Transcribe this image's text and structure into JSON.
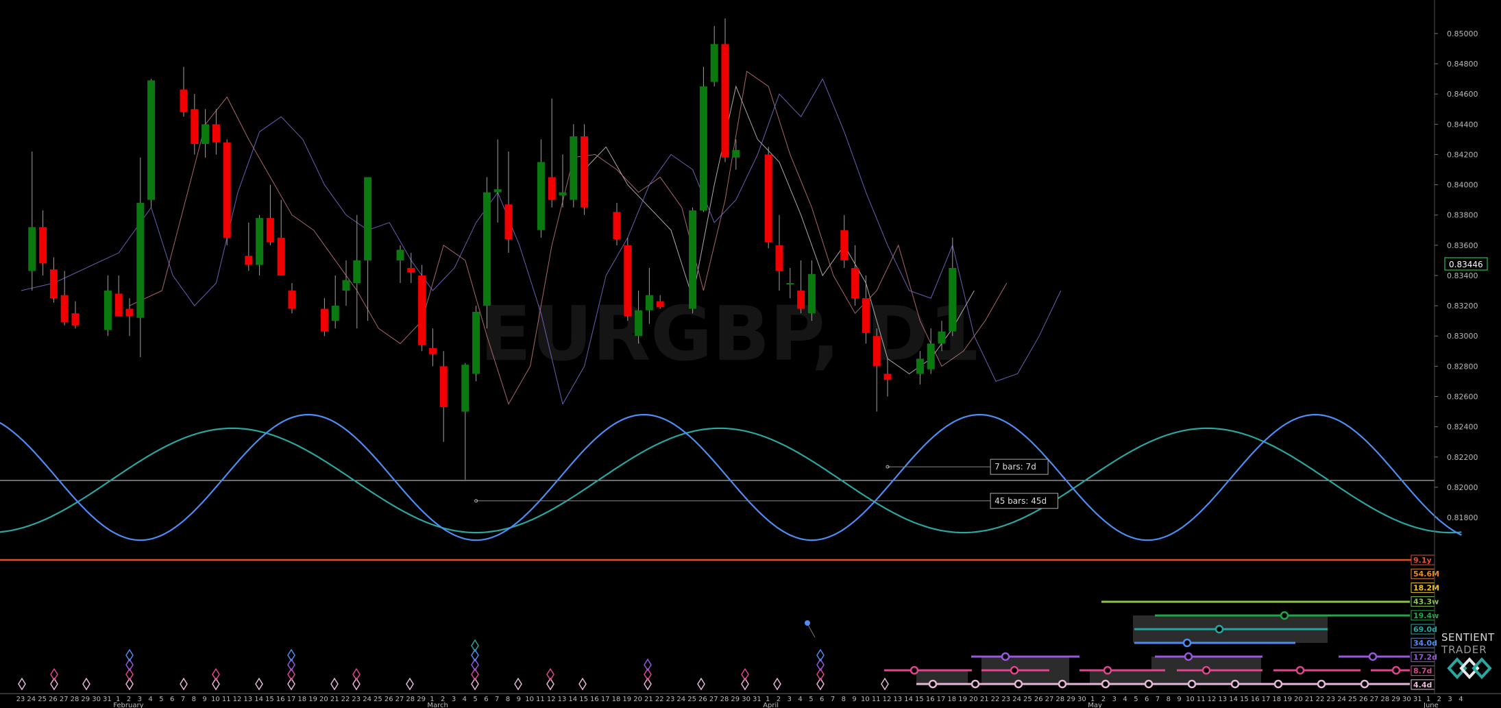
{
  "chart_data": {
    "type": "candlestick",
    "watermark": "EURGBP, D1",
    "last_price": "0.83446",
    "price_axis": [
      "0.85000",
      "0.84800",
      "0.84600",
      "0.84400",
      "0.84200",
      "0.84000",
      "0.83800",
      "0.83600",
      "0.83400",
      "0.83200",
      "0.83000",
      "0.82800",
      "0.82600",
      "0.82400",
      "0.82200",
      "0.82000",
      "0.81800"
    ],
    "ylim": [
      0.8156,
      0.8514
    ],
    "date_labels": [
      "23",
      "24",
      "25",
      "26",
      "27",
      "28",
      "29",
      "30",
      "31",
      "1",
      "2",
      "3",
      "4",
      "5",
      "6",
      "7",
      "8",
      "9",
      "10",
      "11",
      "12",
      "13",
      "14",
      "15",
      "16",
      "17",
      "18",
      "19",
      "20",
      "21",
      "22",
      "23",
      "24",
      "25",
      "26",
      "27",
      "28",
      "29",
      "1",
      "2",
      "3",
      "4",
      "5",
      "6",
      "7",
      "8",
      "9",
      "10",
      "11",
      "12",
      "13",
      "14",
      "15",
      "16",
      "17",
      "18",
      "19",
      "20",
      "21",
      "22",
      "23",
      "24",
      "25",
      "26",
      "27",
      "28",
      "29",
      "30",
      "31",
      "1",
      "2",
      "3",
      "4",
      "5",
      "6",
      "7",
      "8",
      "9",
      "10",
      "11",
      "12",
      "13",
      "14",
      "15",
      "16",
      "17",
      "18",
      "19",
      "20",
      "21",
      "22",
      "23",
      "24",
      "25",
      "26",
      "27",
      "28",
      "29",
      "30",
      "1",
      "2",
      "3",
      "4",
      "5",
      "6",
      "7",
      "8",
      "9",
      "10",
      "11",
      "12",
      "13",
      "14",
      "15",
      "16",
      "17",
      "18",
      "19",
      "20",
      "21",
      "22",
      "23",
      "24",
      "25",
      "26",
      "27",
      "28",
      "29",
      "30",
      "31",
      "1",
      "2",
      "3",
      "4"
    ],
    "month_labels": [
      {
        "index": 9,
        "text": "February"
      },
      {
        "index": 38,
        "text": "March"
      },
      {
        "index": 69,
        "text": "April"
      },
      {
        "index": 99,
        "text": "May"
      },
      {
        "index": 130,
        "text": "June"
      }
    ],
    "candles": [
      {
        "i": 1,
        "o": 0.8343,
        "h": 0.8422,
        "l": 0.833,
        "c": 0.8372
      },
      {
        "i": 2,
        "o": 0.8372,
        "h": 0.8383,
        "l": 0.834,
        "c": 0.8348
      },
      {
        "i": 3,
        "o": 0.8344,
        "h": 0.8352,
        "l": 0.8322,
        "c": 0.8325
      },
      {
        "i": 4,
        "o": 0.8327,
        "h": 0.8343,
        "l": 0.8307,
        "c": 0.8309
      },
      {
        "i": 5,
        "o": 0.8315,
        "h": 0.8323,
        "l": 0.8305,
        "c": 0.8307
      },
      {
        "i": 8,
        "o": 0.8304,
        "h": 0.834,
        "l": 0.83,
        "c": 0.833
      },
      {
        "i": 9,
        "o": 0.8328,
        "h": 0.834,
        "l": 0.8315,
        "c": 0.8313
      },
      {
        "i": 10,
        "o": 0.8318,
        "h": 0.8325,
        "l": 0.83,
        "c": 0.8313
      },
      {
        "i": 11,
        "o": 0.8312,
        "h": 0.8418,
        "l": 0.8286,
        "c": 0.8388
      },
      {
        "i": 12,
        "o": 0.839,
        "h": 0.847,
        "l": 0.8385,
        "c": 0.8469
      },
      {
        "i": 15,
        "o": 0.8463,
        "h": 0.8478,
        "l": 0.8445,
        "c": 0.8448
      },
      {
        "i": 16,
        "o": 0.845,
        "h": 0.846,
        "l": 0.842,
        "c": 0.8427
      },
      {
        "i": 17,
        "o": 0.8427,
        "h": 0.845,
        "l": 0.8418,
        "c": 0.844
      },
      {
        "i": 18,
        "o": 0.844,
        "h": 0.845,
        "l": 0.842,
        "c": 0.8428
      },
      {
        "i": 19,
        "o": 0.8428,
        "h": 0.843,
        "l": 0.836,
        "c": 0.8365
      },
      {
        "i": 21,
        "o": 0.8353,
        "h": 0.8375,
        "l": 0.8343,
        "c": 0.8347
      },
      {
        "i": 22,
        "o": 0.8347,
        "h": 0.838,
        "l": 0.834,
        "c": 0.8378
      },
      {
        "i": 23,
        "o": 0.8378,
        "h": 0.84,
        "l": 0.836,
        "c": 0.8362
      },
      {
        "i": 24,
        "o": 0.8365,
        "h": 0.839,
        "l": 0.834,
        "c": 0.834
      },
      {
        "i": 25,
        "o": 0.833,
        "h": 0.8335,
        "l": 0.8315,
        "c": 0.8318
      },
      {
        "i": 28,
        "o": 0.8318,
        "h": 0.8325,
        "l": 0.83,
        "c": 0.8303
      },
      {
        "i": 29,
        "o": 0.831,
        "h": 0.834,
        "l": 0.8305,
        "c": 0.832
      },
      {
        "i": 30,
        "o": 0.833,
        "h": 0.835,
        "l": 0.832,
        "c": 0.8337
      },
      {
        "i": 31,
        "o": 0.8335,
        "h": 0.838,
        "l": 0.8305,
        "c": 0.835
      },
      {
        "i": 32,
        "o": 0.835,
        "h": 0.8405,
        "l": 0.831,
        "c": 0.8405
      },
      {
        "i": 35,
        "o": 0.835,
        "h": 0.836,
        "l": 0.8335,
        "c": 0.8357
      },
      {
        "i": 36,
        "o": 0.8345,
        "h": 0.8355,
        "l": 0.8335,
        "c": 0.8342
      },
      {
        "i": 37,
        "o": 0.834,
        "h": 0.8347,
        "l": 0.829,
        "c": 0.8294
      },
      {
        "i": 38,
        "o": 0.8292,
        "h": 0.8305,
        "l": 0.828,
        "c": 0.8288
      },
      {
        "i": 39,
        "o": 0.828,
        "h": 0.829,
        "l": 0.823,
        "c": 0.8253
      },
      {
        "i": 41,
        "o": 0.825,
        "h": 0.8282,
        "l": 0.8205,
        "c": 0.8281
      },
      {
        "i": 42,
        "o": 0.8275,
        "h": 0.832,
        "l": 0.827,
        "c": 0.8316
      },
      {
        "i": 43,
        "o": 0.832,
        "h": 0.8405,
        "l": 0.8305,
        "c": 0.8395
      },
      {
        "i": 44,
        "o": 0.8395,
        "h": 0.843,
        "l": 0.8375,
        "c": 0.8397
      },
      {
        "i": 45,
        "o": 0.8387,
        "h": 0.8422,
        "l": 0.8355,
        "c": 0.8364
      },
      {
        "i": 48,
        "o": 0.837,
        "h": 0.843,
        "l": 0.8365,
        "c": 0.8415
      },
      {
        "i": 49,
        "o": 0.8405,
        "h": 0.8457,
        "l": 0.8385,
        "c": 0.839
      },
      {
        "i": 50,
        "o": 0.8393,
        "h": 0.842,
        "l": 0.8385,
        "c": 0.8395
      },
      {
        "i": 51,
        "o": 0.839,
        "h": 0.844,
        "l": 0.8385,
        "c": 0.8432
      },
      {
        "i": 52,
        "o": 0.8432,
        "h": 0.844,
        "l": 0.838,
        "c": 0.8385
      },
      {
        "i": 55,
        "o": 0.8382,
        "h": 0.8388,
        "l": 0.836,
        "c": 0.8364
      },
      {
        "i": 56,
        "o": 0.836,
        "h": 0.8365,
        "l": 0.831,
        "c": 0.8313
      },
      {
        "i": 57,
        "o": 0.83,
        "h": 0.833,
        "l": 0.8295,
        "c": 0.8317
      },
      {
        "i": 58,
        "o": 0.8317,
        "h": 0.8345,
        "l": 0.8308,
        "c": 0.8327
      },
      {
        "i": 59,
        "o": 0.8323,
        "h": 0.8327,
        "l": 0.8318,
        "c": 0.8319
      },
      {
        "i": 62,
        "o": 0.8318,
        "h": 0.8385,
        "l": 0.8315,
        "c": 0.8383
      },
      {
        "i": 63,
        "o": 0.8383,
        "h": 0.8478,
        "l": 0.8382,
        "c": 0.8465
      },
      {
        "i": 64,
        "o": 0.8468,
        "h": 0.8505,
        "l": 0.8465,
        "c": 0.8493
      },
      {
        "i": 65,
        "o": 0.8493,
        "h": 0.851,
        "l": 0.8415,
        "c": 0.8418
      },
      {
        "i": 66,
        "o": 0.8418,
        "h": 0.843,
        "l": 0.841,
        "c": 0.8423
      },
      {
        "i": 69,
        "o": 0.842,
        "h": 0.8425,
        "l": 0.8358,
        "c": 0.8362
      },
      {
        "i": 70,
        "o": 0.836,
        "h": 0.838,
        "l": 0.833,
        "c": 0.8343
      },
      {
        "i": 71,
        "o": 0.8335,
        "h": 0.8345,
        "l": 0.8325,
        "c": 0.8335
      },
      {
        "i": 72,
        "o": 0.833,
        "h": 0.835,
        "l": 0.8315,
        "c": 0.8318
      },
      {
        "i": 73,
        "o": 0.8315,
        "h": 0.835,
        "l": 0.831,
        "c": 0.8341
      },
      {
        "i": 76,
        "o": 0.837,
        "h": 0.838,
        "l": 0.8345,
        "c": 0.835
      },
      {
        "i": 77,
        "o": 0.8345,
        "h": 0.836,
        "l": 0.832,
        "c": 0.8325
      },
      {
        "i": 78,
        "o": 0.8325,
        "h": 0.834,
        "l": 0.8295,
        "c": 0.8302
      },
      {
        "i": 79,
        "o": 0.83,
        "h": 0.8305,
        "l": 0.825,
        "c": 0.828
      },
      {
        "i": 80,
        "o": 0.8275,
        "h": 0.8285,
        "l": 0.826,
        "c": 0.8271
      },
      {
        "i": 83,
        "o": 0.8275,
        "h": 0.829,
        "l": 0.8268,
        "c": 0.8285
      },
      {
        "i": 84,
        "o": 0.8278,
        "h": 0.8305,
        "l": 0.8275,
        "c": 0.8295
      },
      {
        "i": 85,
        "o": 0.8295,
        "h": 0.831,
        "l": 0.829,
        "c": 0.8303
      },
      {
        "i": 86,
        "o": 0.8303,
        "h": 0.8365,
        "l": 0.83,
        "c": 0.8345
      }
    ],
    "overlay_lines": [
      {
        "name": "",
        "color": "#c9c9c9",
        "points": [
          [
            52,
            0.841
          ],
          [
            54,
            0.8425
          ],
          [
            56,
            0.84
          ],
          [
            58,
            0.8385
          ],
          [
            60,
            0.837
          ],
          [
            62,
            0.8325
          ],
          [
            64,
            0.84
          ],
          [
            66,
            0.8465
          ],
          [
            68,
            0.843
          ],
          [
            70,
            0.8415
          ],
          [
            72,
            0.838
          ],
          [
            74,
            0.834
          ],
          [
            76,
            0.836
          ],
          [
            78,
            0.8335
          ],
          [
            80,
            0.8285
          ],
          [
            82,
            0.8275
          ],
          [
            84,
            0.8285
          ],
          [
            86,
            0.8305
          ],
          [
            88,
            0.833
          ]
        ]
      },
      {
        "name": "",
        "color": "#c87a7a",
        "points": [
          [
            10,
            0.832
          ],
          [
            13,
            0.833
          ],
          [
            15,
            0.8385
          ],
          [
            17,
            0.844
          ],
          [
            19,
            0.8458
          ],
          [
            21,
            0.843
          ],
          [
            23,
            0.8405
          ],
          [
            25,
            0.838
          ],
          [
            27,
            0.837
          ],
          [
            29,
            0.835
          ],
          [
            31,
            0.833
          ],
          [
            33,
            0.8305
          ],
          [
            35,
            0.8295
          ],
          [
            37,
            0.831
          ],
          [
            39,
            0.836
          ],
          [
            41,
            0.835
          ],
          [
            43,
            0.83
          ],
          [
            45,
            0.8255
          ],
          [
            47,
            0.828
          ],
          [
            49,
            0.836
          ],
          [
            51,
            0.8418
          ],
          [
            53,
            0.842
          ],
          [
            55,
            0.841
          ],
          [
            57,
            0.8395
          ],
          [
            59,
            0.8405
          ],
          [
            61,
            0.8385
          ],
          [
            63,
            0.833
          ],
          [
            65,
            0.839
          ],
          [
            67,
            0.8475
          ],
          [
            69,
            0.8465
          ],
          [
            71,
            0.842
          ],
          [
            73,
            0.8385
          ],
          [
            75,
            0.834
          ],
          [
            77,
            0.8315
          ],
          [
            79,
            0.833
          ],
          [
            81,
            0.836
          ],
          [
            83,
            0.831
          ],
          [
            85,
            0.828
          ],
          [
            87,
            0.829
          ],
          [
            89,
            0.831
          ],
          [
            91,
            0.8335
          ]
        ]
      },
      {
        "name": "",
        "color": "#7a72d4",
        "points": [
          [
            0,
            0.833
          ],
          [
            3,
            0.8335
          ],
          [
            6,
            0.8345
          ],
          [
            9,
            0.8355
          ],
          [
            12,
            0.8385
          ],
          [
            14,
            0.834
          ],
          [
            16,
            0.832
          ],
          [
            18,
            0.8335
          ],
          [
            20,
            0.8395
          ],
          [
            22,
            0.8435
          ],
          [
            24,
            0.8445
          ],
          [
            26,
            0.843
          ],
          [
            28,
            0.84
          ],
          [
            30,
            0.838
          ],
          [
            32,
            0.837
          ],
          [
            34,
            0.8375
          ],
          [
            36,
            0.835
          ],
          [
            38,
            0.833
          ],
          [
            40,
            0.8345
          ],
          [
            42,
            0.8375
          ],
          [
            44,
            0.8395
          ],
          [
            46,
            0.836
          ],
          [
            48,
            0.8315
          ],
          [
            50,
            0.8255
          ],
          [
            52,
            0.828
          ],
          [
            54,
            0.834
          ],
          [
            56,
            0.8365
          ],
          [
            58,
            0.84
          ],
          [
            60,
            0.842
          ],
          [
            62,
            0.841
          ],
          [
            64,
            0.8375
          ],
          [
            66,
            0.839
          ],
          [
            68,
            0.842
          ],
          [
            70,
            0.846
          ],
          [
            72,
            0.8445
          ],
          [
            74,
            0.847
          ],
          [
            76,
            0.8435
          ],
          [
            78,
            0.8395
          ],
          [
            80,
            0.836
          ],
          [
            82,
            0.833
          ],
          [
            84,
            0.8325
          ],
          [
            86,
            0.836
          ],
          [
            88,
            0.83
          ],
          [
            90,
            0.827
          ],
          [
            92,
            0.8275
          ],
          [
            94,
            0.83
          ],
          [
            96,
            0.833
          ]
        ]
      }
    ],
    "horizontal_line": 0.82045,
    "cycles": [
      {
        "period_bars": 45,
        "amplitude": 0.00345,
        "center": 0.82045,
        "phase_trough_index": 42,
        "color": "#2aa7a1"
      },
      {
        "period_bars": 31,
        "amplitude": 0.00415,
        "center": 0.82065,
        "phase_trough_index": 42,
        "color": "#4e8df5"
      }
    ],
    "annotations": [
      {
        "text": "7 bars: 7d",
        "anchor_index": 80,
        "anchor_price": 0.82135,
        "box_index": 89.5,
        "box_price": 0.82135
      },
      {
        "text": "45 bars: 45d",
        "anchor_index": 42,
        "anchor_price": 0.8191,
        "box_index": 89.5,
        "box_price": 0.8191
      }
    ],
    "cycle_legend": [
      {
        "label": "9.1y",
        "color": "#e84d2c"
      },
      {
        "label": "54.6M",
        "color": "#f08a1e"
      },
      {
        "label": "18.2M",
        "color": "#f0c419"
      },
      {
        "label": "43.3w",
        "color": "#8bc34a"
      },
      {
        "label": "19.4w",
        "color": "#1fa84a"
      },
      {
        "label": "69.0d",
        "color": "#26a6a0"
      },
      {
        "label": "34.0d",
        "color": "#4e8df5"
      },
      {
        "label": "17.2d",
        "color": "#9a57e0"
      },
      {
        "label": "8.7d",
        "color": "#e0468e"
      },
      {
        "label": "4.4d",
        "color": "#e8b8d8"
      }
    ],
    "brand": [
      "SENTIENT",
      "TRADER"
    ]
  }
}
